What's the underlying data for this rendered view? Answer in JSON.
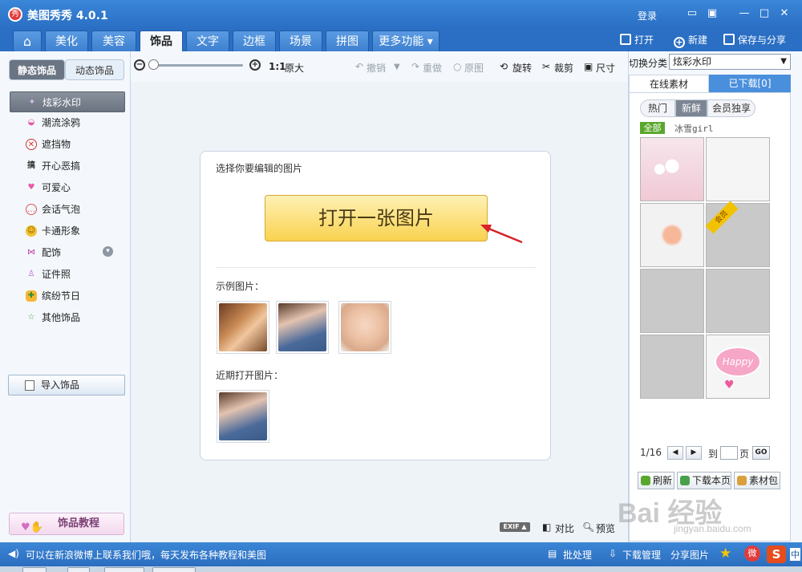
{
  "app": {
    "title": "美图秀秀 4.0.1",
    "login": "登录"
  },
  "tabs": [
    {
      "label": "⌂"
    },
    {
      "label": "美化"
    },
    {
      "label": "美容"
    },
    {
      "label": "饰品"
    },
    {
      "label": "文字"
    },
    {
      "label": "边框"
    },
    {
      "label": "场景"
    },
    {
      "label": "拼图"
    },
    {
      "label": "更多功能 ▾"
    }
  ],
  "top_actions": {
    "open": "打开",
    "new": "新建",
    "save_share": "保存与分享"
  },
  "left": {
    "tabs": {
      "static": "静态饰品",
      "dynamic": "动态饰品"
    },
    "categories": [
      {
        "label": "炫彩水印",
        "icon": "sparkle-icon"
      },
      {
        "label": "潮流涂鸦",
        "icon": "lips-icon"
      },
      {
        "label": "遮挡物",
        "icon": "mask-icon"
      },
      {
        "label": "开心恶搞",
        "icon": "prank-icon"
      },
      {
        "label": "可爱心",
        "icon": "heart-icon"
      },
      {
        "label": "会话气泡",
        "icon": "speech-bubble-icon"
      },
      {
        "label": "卡通形象",
        "icon": "cartoon-icon"
      },
      {
        "label": "配饰",
        "icon": "bow-icon"
      },
      {
        "label": "证件照",
        "icon": "id-photo-icon"
      },
      {
        "label": "缤纷节日",
        "icon": "gift-icon"
      },
      {
        "label": "其他饰品",
        "icon": "star-icon"
      }
    ],
    "import_label": "导入饰品",
    "tutorial_label": "饰品教程"
  },
  "toolbar": {
    "ratio": "1:1",
    "original_size": "原大",
    "undo": "撤销",
    "redo": "重做",
    "original": "原图",
    "rotate": "旋转",
    "crop": "裁剪",
    "size": "尺寸"
  },
  "canvas": {
    "choose_label": "选择你要编辑的图片",
    "open_button": "打开一张图片",
    "sample_label": "示例图片：",
    "recent_label": "近期打开图片：",
    "exif": "EXIF ▲",
    "compare": "对比",
    "preview": "预览"
  },
  "right": {
    "switch_label": "切换分类",
    "category_value": "炫彩水印",
    "tabs": {
      "online": "在线素材",
      "downloaded": "已下载[0]"
    },
    "pills": {
      "hot": "热门",
      "fresh": "新鲜",
      "member": "会员独享"
    },
    "all": "全部",
    "user": "冰雪girl",
    "member_ribbon": "会员",
    "happy": "Happy",
    "pager": {
      "page": "1/16",
      "goto": "到",
      "unit": "页",
      "go": "GO"
    },
    "buttons": {
      "refresh": "刷新",
      "download_page": "下载本页",
      "pack": "素材包"
    }
  },
  "status": {
    "message": "可以在新浪微博上联系我们哦，每天发布各种教程和美图",
    "batch": "批处理",
    "downloader": "下载管理",
    "share": "分享图片"
  },
  "watermark": {
    "main": "Bai 经验",
    "sub": "jingyan.baidu.com"
  },
  "colors": {
    "titlebar": "#2a6fc4",
    "accent_yellow": "#f9d24f",
    "arrow_red": "#d8222a"
  }
}
